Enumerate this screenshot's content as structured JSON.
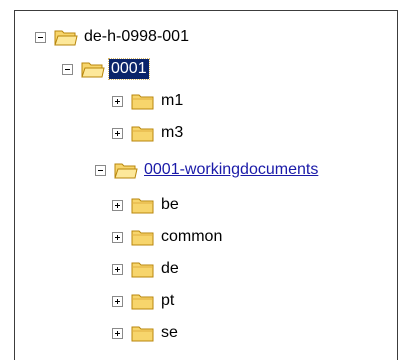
{
  "tree": {
    "root": {
      "label": "de-h-0998-001",
      "expanded": true
    },
    "items": [
      {
        "label": "0001",
        "expanded": true,
        "selected": true
      },
      {
        "label": "m1",
        "expanded": false
      },
      {
        "label": "m3",
        "expanded": false
      },
      {
        "label": "0001-workingdocuments",
        "expanded": true,
        "hyperlinked": true
      },
      {
        "label": "be",
        "expanded": false
      },
      {
        "label": "common",
        "expanded": false
      },
      {
        "label": "de",
        "expanded": false
      },
      {
        "label": "pt",
        "expanded": false
      },
      {
        "label": "se",
        "expanded": false
      }
    ]
  },
  "icons": {
    "expand": "plus-box-icon",
    "collapse": "minus-box-icon",
    "folder": "folder-icon"
  },
  "colors": {
    "selection_bg": "#0a246a",
    "selection_text": "#ffffff",
    "link_text": "#1a1aa8",
    "folder_fill": "#f7d56c",
    "folder_edge": "#b8860b"
  }
}
